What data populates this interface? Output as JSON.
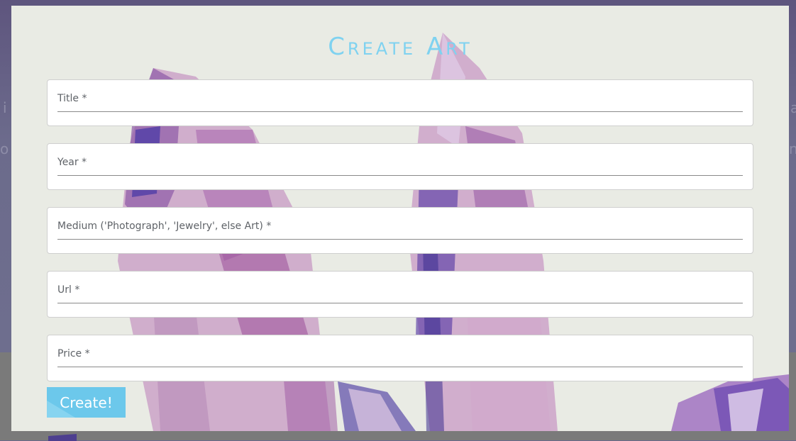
{
  "backdrop": {
    "ghost_left_1": "i",
    "ghost_left_2": "o",
    "ghost_right_1": "a",
    "ghost_right_2": "n"
  },
  "modal": {
    "title": "Create Art",
    "fields": [
      {
        "label": "Title *"
      },
      {
        "label": "Year *"
      },
      {
        "label": "Medium ('Photograph', 'Jewelry', else Art) *"
      },
      {
        "label": "Url *"
      },
      {
        "label": "Price *"
      }
    ],
    "submit_label": "Create!"
  },
  "colors": {
    "title": "#7fd2f0",
    "button": "#6cc8eb",
    "crystal_purple": "#9b5aa8",
    "crystal_pink": "#c79ac4",
    "crystal_indigo": "#4b3aa6"
  }
}
